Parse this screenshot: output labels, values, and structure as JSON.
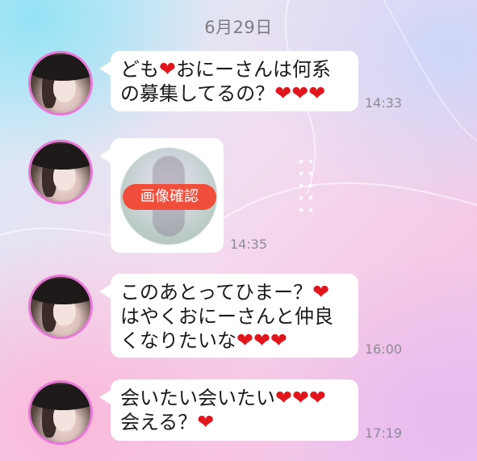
{
  "date_header": "6月29日",
  "colors": {
    "heart": "#e0161c",
    "avatar_ring": "#e879d6",
    "confirm_button": "#f04e3b"
  },
  "messages": [
    {
      "text_lines": [
        "ども",
        "おにーさんは何系",
        "の募集してるの？"
      ],
      "time": "14:33"
    },
    {
      "type": "image",
      "button_label": "画像確認",
      "time": "14:35"
    },
    {
      "text_lines": [
        "このあとってひまー？",
        "はやくおにーさんと仲良",
        "くなりたいな"
      ],
      "time": "16:00"
    },
    {
      "text_lines": [
        "会いたい会いたい",
        "会える？"
      ],
      "time": "17:19"
    }
  ],
  "hearts": {
    "glyph": "❤"
  }
}
